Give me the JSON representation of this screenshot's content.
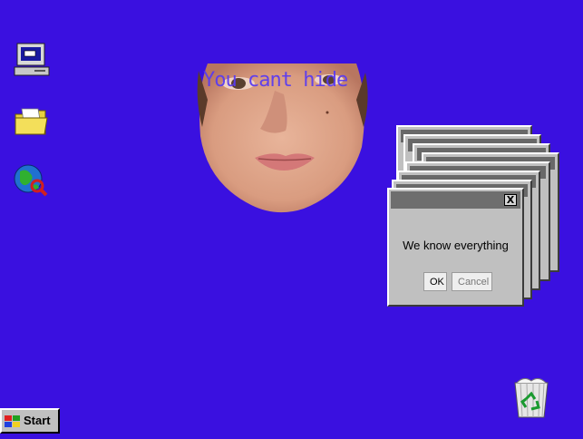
{
  "desktop": {
    "icons": [
      {
        "name": "my-computer-icon"
      },
      {
        "name": "folder-icon"
      },
      {
        "name": "internet-explorer-icon"
      }
    ],
    "overlay_text": "You cant hide",
    "recycle_icon": "recycle-bin-icon"
  },
  "dialog": {
    "close_label": "X",
    "message": "We know everything",
    "ok_label": "OK",
    "cancel_label": "Cancel"
  },
  "taskbar": {
    "start_label": "Start"
  },
  "colors": {
    "desktop_bg": "#3a10e0",
    "window_face": "#c0c0c0",
    "title_bar": "#6e6e6e"
  }
}
